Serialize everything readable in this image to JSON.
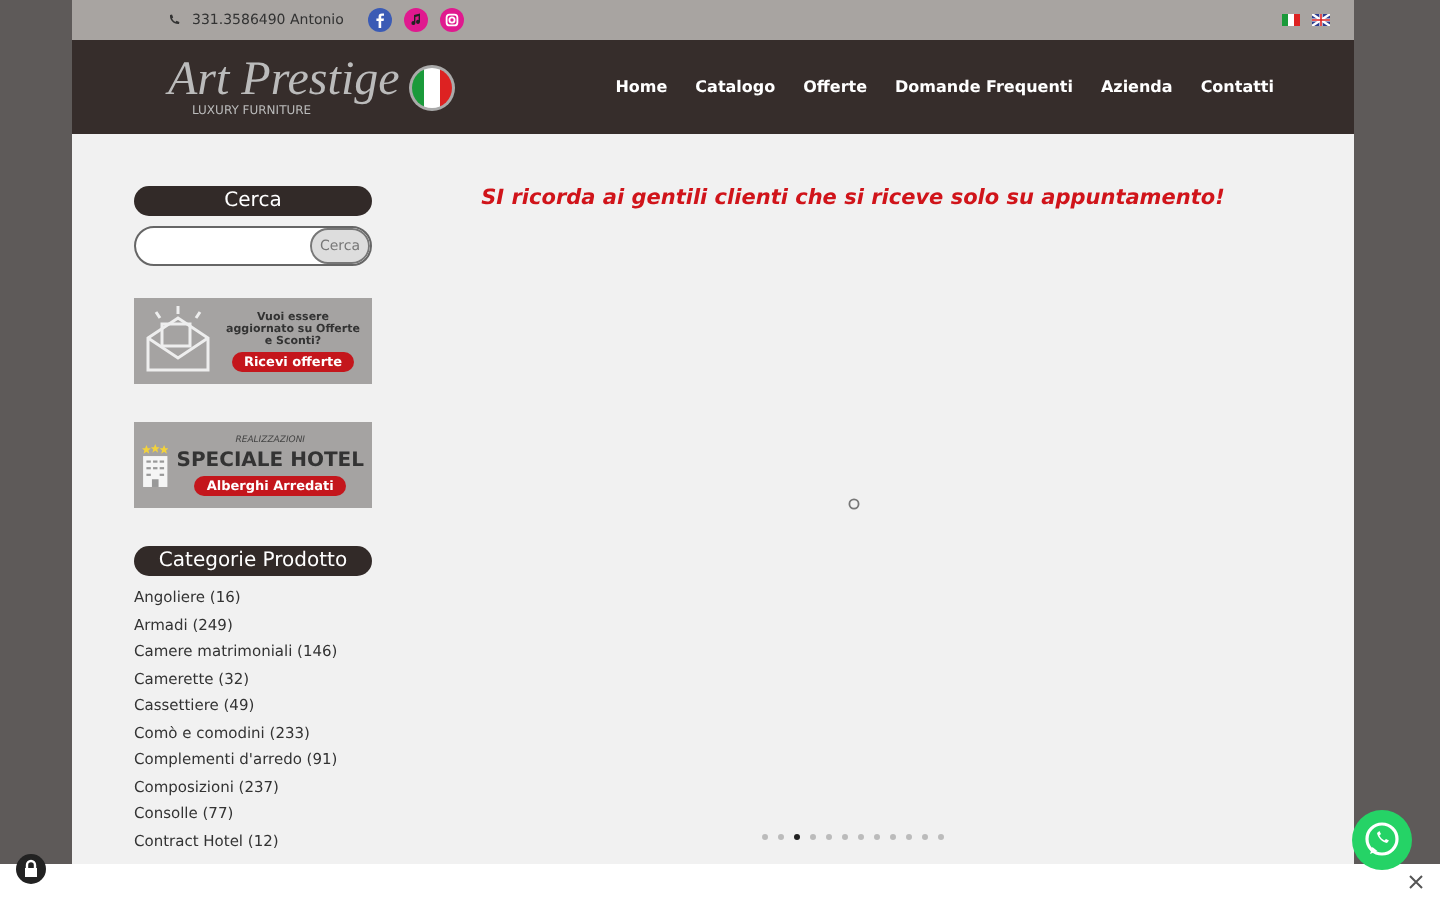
{
  "top_bar": {
    "phone": "331.3586490 Antonio",
    "social": [
      {
        "kind": "facebook"
      },
      {
        "kind": "music"
      },
      {
        "kind": "instagram"
      }
    ],
    "languages": [
      {
        "kind": "it"
      },
      {
        "kind": "en"
      }
    ]
  },
  "header": {
    "logo": {
      "title": "Art Prestige",
      "subtitle": "LUXURY FURNITURE"
    },
    "nav": [
      "Home",
      "Catalogo",
      "Offerte",
      "Domande Frequenti",
      "Azienda",
      "Contatti"
    ]
  },
  "sidebar": {
    "search": {
      "title": "Cerca",
      "button": "Cerca"
    },
    "offers_banner": {
      "text": "Vuoi essere aggiornato su Offerte e Sconti?",
      "button": "Ricevi offerte"
    },
    "hotel_banner": {
      "overline": "REALIZZAZIONI",
      "title": "SPECIALE HOTEL",
      "button": "Alberghi Arredati"
    },
    "categories": {
      "title": "Categorie Prodotto",
      "items": [
        "Angoliere (16)",
        "Armadi (249)",
        "Camere matrimoniali (146)",
        "Camerette (32)",
        "Cassettiere (49)",
        "Comò e comodini (233)",
        "Complementi d'arredo (91)",
        "Composizioni (237)",
        "Consolle (77)",
        "Contract Hotel (12)"
      ]
    }
  },
  "main": {
    "notice": "SI ricorda ai gentili clienti che si riceve solo su appuntamento!",
    "slider_dots": [
      {
        "selected": false
      },
      {
        "selected": false
      },
      {
        "selected": true
      },
      {
        "selected": false
      },
      {
        "selected": false
      },
      {
        "selected": false
      },
      {
        "selected": false
      },
      {
        "selected": false
      },
      {
        "selected": false
      },
      {
        "selected": false
      },
      {
        "selected": false
      },
      {
        "selected": false
      }
    ]
  }
}
